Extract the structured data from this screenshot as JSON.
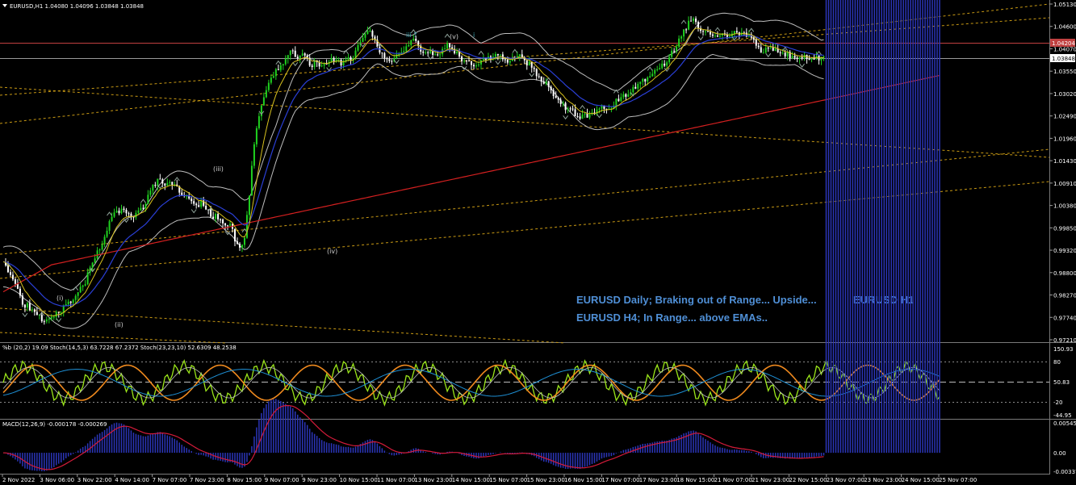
{
  "header": {
    "symbol_line": "EURUSD,H1  1.04080 1.04096 1.03848 1.03848"
  },
  "indicators": {
    "oscillator_label": "%b (20,2) 19.09  Stoch(14,5,3) 63.7228 67.2372  Stoch(23,23,10) 52.6309 48.2538",
    "macd_label": "MACD(12,26,9) -0.000178 -0.000269"
  },
  "annotations": {
    "daily": "EURUSD Daily; Braking out of Range... Upside...",
    "h4": "EURUSD H4; In Range... above EMAs..",
    "h1": "EURUSD H1"
  },
  "colors": {
    "background": "#000000",
    "bull_candle": "#1fd11f",
    "bear_candle": "#ffffff",
    "ema_fast": "#d8c21e",
    "ema_mid": "#2a3fd6",
    "ema_slow": "#d42020",
    "bands": "#bdbdbd",
    "channel": "#c99a14",
    "macd_hist": "#2b35b8",
    "macd_signal": "#d41b3a",
    "stoch_fast": "#9be61a",
    "stoch_slow": "#f08a1e",
    "price_tag": "#c04040",
    "annotation_text": "#4f8fd6"
  },
  "chart_data": [
    {
      "type": "line",
      "panel": "price",
      "title": "EURUSD,H1",
      "ylim": [
        0.971,
        1.0515
      ],
      "y_ticks": [
        "1.05130",
        "1.04600",
        "1.04070",
        "1.03550",
        "1.03020",
        "1.02490",
        "1.01960",
        "1.01430",
        "1.00910",
        "1.00380",
        "0.99850",
        "0.99320",
        "0.98800",
        "0.98270",
        "0.97740",
        "0.97210"
      ],
      "x_ticks": [
        "2 Nov 2022",
        "3 Nov 06:00",
        "3 Nov 22:00",
        "4 Nov 14:00",
        "7 Nov 07:00",
        "7 Nov 23:00",
        "8 Nov 15:00",
        "9 Nov 07:00",
        "9 Nov 23:00",
        "10 Nov 15:00",
        "11 Nov 07:00",
        "13 Nov 23:00",
        "14 Nov 15:00",
        "15 Nov 07:00",
        "15 Nov 23:00",
        "16 Nov 15:00",
        "17 Nov 07:00",
        "17 Nov 23:00",
        "18 Nov 15:00",
        "21 Nov 07:00",
        "21 Nov 23:00",
        "22 Nov 15:00",
        "23 Nov 07:00",
        "23 Nov 23:00",
        "24 Nov 15:00",
        "25 Nov 07:00"
      ],
      "price_tags": [
        {
          "value": "1.04204",
          "color": "#c04040"
        },
        {
          "value": "1.03848",
          "color": "#ffffff"
        }
      ],
      "wave_labels": [
        "(i)",
        "(ii)",
        "(iii)",
        "(iv)",
        "(v)",
        "iii ?",
        "i"
      ],
      "close_series": {
        "name": "",
        "x_index": [
          0,
          6,
          12,
          18,
          24,
          30,
          36,
          42,
          48,
          54,
          60,
          66,
          72,
          78,
          84,
          90,
          96,
          102,
          108,
          114,
          120,
          126,
          132,
          138,
          144,
          150,
          156,
          162,
          168,
          174,
          180,
          186,
          192,
          198,
          204,
          210,
          216,
          222,
          228,
          234,
          240,
          246,
          252,
          258,
          264,
          270,
          276,
          282,
          288,
          294,
          300,
          306,
          312,
          318,
          324,
          330,
          336,
          342,
          348,
          354,
          360,
          366,
          372,
          378,
          384,
          390,
          396,
          402,
          408,
          414,
          420,
          426,
          432,
          438,
          444,
          450,
          456,
          462,
          468,
          474,
          480,
          486,
          492,
          498,
          504,
          510,
          516,
          522,
          528,
          534,
          540,
          546,
          552,
          558,
          564,
          570,
          576,
          582,
          588,
          594,
          600,
          606,
          612,
          618,
          624,
          630,
          636,
          642,
          648,
          654,
          660,
          666,
          672,
          678,
          684,
          690,
          696,
          702,
          708,
          714,
          720,
          726,
          732,
          738,
          744,
          750,
          756,
          762,
          768,
          774,
          780,
          786,
          792,
          798,
          804,
          810,
          816,
          822,
          828,
          834,
          840,
          846,
          852,
          858,
          864,
          870,
          876,
          882,
          888,
          894,
          900,
          906,
          912,
          918,
          924,
          930,
          936,
          942,
          948,
          954,
          960,
          966,
          972,
          978,
          984,
          990,
          996,
          1002,
          1008,
          1014,
          1020,
          1026,
          1032,
          1038,
          1044,
          1050,
          1056,
          1062,
          1068,
          1074,
          1080,
          1086,
          1092,
          1098,
          1104,
          1110,
          1116,
          1122,
          1128,
          1134,
          1140,
          1146,
          1152,
          1158,
          1164
        ],
        "values": [
          0.9905,
          0.987,
          0.986,
          0.983,
          0.98,
          0.979,
          0.9775,
          0.977,
          0.976,
          0.976,
          0.977,
          0.9775,
          0.978,
          0.98,
          0.9805,
          0.981,
          0.983,
          0.985,
          0.988,
          0.9905,
          0.993,
          0.996,
          0.999,
          1.001,
          1.002,
          1.0015,
          1.0005,
          1.001,
          1.002,
          1.0025,
          1.005,
          1.0075,
          1.0095,
          1.009,
          1.008,
          1.0085,
          1.007,
          1.006,
          1.005,
          1.0045,
          1.003,
          1.004,
          1.002,
          1.001,
          1.0005,
          1.0,
          0.9985,
          0.999,
          0.995,
          0.993,
          0.996,
          1.006,
          1.018,
          1.024,
          1.029,
          1.032,
          1.0345,
          1.036,
          1.0375,
          1.0395,
          1.0405,
          1.0385,
          1.039,
          1.038,
          1.037,
          1.0375,
          1.0365,
          1.037,
          1.038,
          1.0385,
          1.037,
          1.038,
          1.0385,
          1.04,
          1.042,
          1.044,
          1.0455,
          1.043,
          1.04,
          1.0385,
          1.0375,
          1.038,
          1.0395,
          1.0405,
          1.042,
          1.0425,
          1.0415,
          1.04,
          1.0405,
          1.039,
          1.0395,
          1.041,
          1.0415,
          1.0405,
          1.0395,
          1.0385,
          1.038,
          1.037,
          1.0365,
          1.0375,
          1.038,
          1.0385,
          1.039,
          1.0395,
          1.0385,
          1.0375,
          1.038,
          1.039,
          1.038,
          1.037,
          1.0355,
          1.034,
          1.033,
          1.032,
          1.03,
          1.0285,
          1.027,
          1.026,
          1.0255,
          1.025,
          1.0245,
          1.025,
          1.0255,
          1.026,
          1.0265,
          1.0265,
          1.027,
          1.028,
          1.029,
          1.03,
          1.031,
          1.032,
          1.033,
          1.0335,
          1.0345,
          1.0355,
          1.0365,
          1.0375,
          1.039,
          1.041,
          1.043,
          1.045,
          1.047,
          1.048,
          1.046,
          1.0455,
          1.045,
          1.0445,
          1.044,
          1.0438,
          1.044,
          1.0445,
          1.0442,
          1.044,
          1.0438,
          1.0435,
          1.042,
          1.04,
          1.0405,
          1.041,
          1.0405,
          1.04,
          1.0395,
          1.039,
          1.0388,
          1.039,
          1.0392,
          1.039,
          1.0388,
          1.0385
        ]
      }
    },
    {
      "type": "line",
      "panel": "oscillator",
      "ylim": [
        -44.95,
        150.93
      ],
      "y_ticks": [
        "150.93",
        "80",
        "50.83",
        "-20",
        "-44.95"
      ],
      "series_names": []
    },
    {
      "type": "bar",
      "panel": "macd",
      "ylim": [
        -0.003376,
        0.005456
      ],
      "y_ticks": [
        "0.005456",
        "0.00",
        "-0.003376"
      ],
      "series_names": []
    }
  ]
}
